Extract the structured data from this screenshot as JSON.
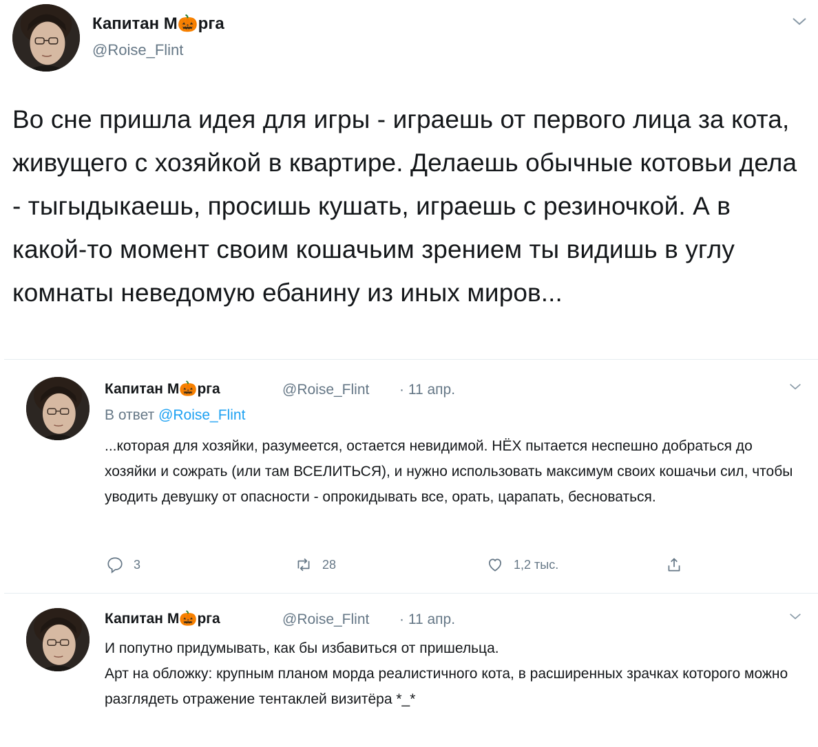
{
  "tweet": {
    "author_name": "Капитан М🎃рга",
    "author_handle": "@Roise_Flint",
    "text": "Во сне пришла идея для игры - играешь от первого лица за кота, живущего с хозяйкой в квартире. Делаешь обычные котовьи дела - тыгыдыкаешь, просишь кушать, играешь с резиночкой. А в какой-то момент своим кошачьим зрением ты видишь в углу комнаты неведомую ебанину из иных миров..."
  },
  "replies": [
    {
      "author_name": "Капитан М🎃рга",
      "author_handle": "@Roise_Flint",
      "date": "· 11 апр.",
      "reply_to_prefix": "В ответ",
      "reply_to_handle": "@Roise_Flint",
      "text": "...которая для хозяйки, разумеется, остается невидимой. НЁХ пытается неспешно добраться до хозяйки и сожрать (или там ВСЕЛИТЬСЯ), и нужно использовать максимум своих кошачьи сил, чтобы уводить девушку от опасности - опрокидывать все, орать, царапать, бесноваться.",
      "actions": {
        "reply_count": "3",
        "retweet_count": "28",
        "like_count": "1,2 тыс."
      }
    },
    {
      "author_name": "Капитан М🎃рга",
      "author_handle": "@Roise_Flint",
      "date": "· 11 апр.",
      "text_line1": "И попутно придумывать, как бы избавиться от пришельца.",
      "text_line2": "Арт на обложку: крупным планом морда реалистичного кота, в расширенных зрачках которого можно разглядеть отражение тентаклей визитёра *_*"
    }
  ],
  "colors": {
    "primary_text": "#14171a",
    "secondary_text": "#657786",
    "link": "#1da1f2",
    "divider": "#e6ecf0"
  },
  "icons": [
    "chevron-down-icon",
    "reply-icon",
    "retweet-icon",
    "like-icon",
    "share-icon",
    "pumpkin-emoji"
  ]
}
